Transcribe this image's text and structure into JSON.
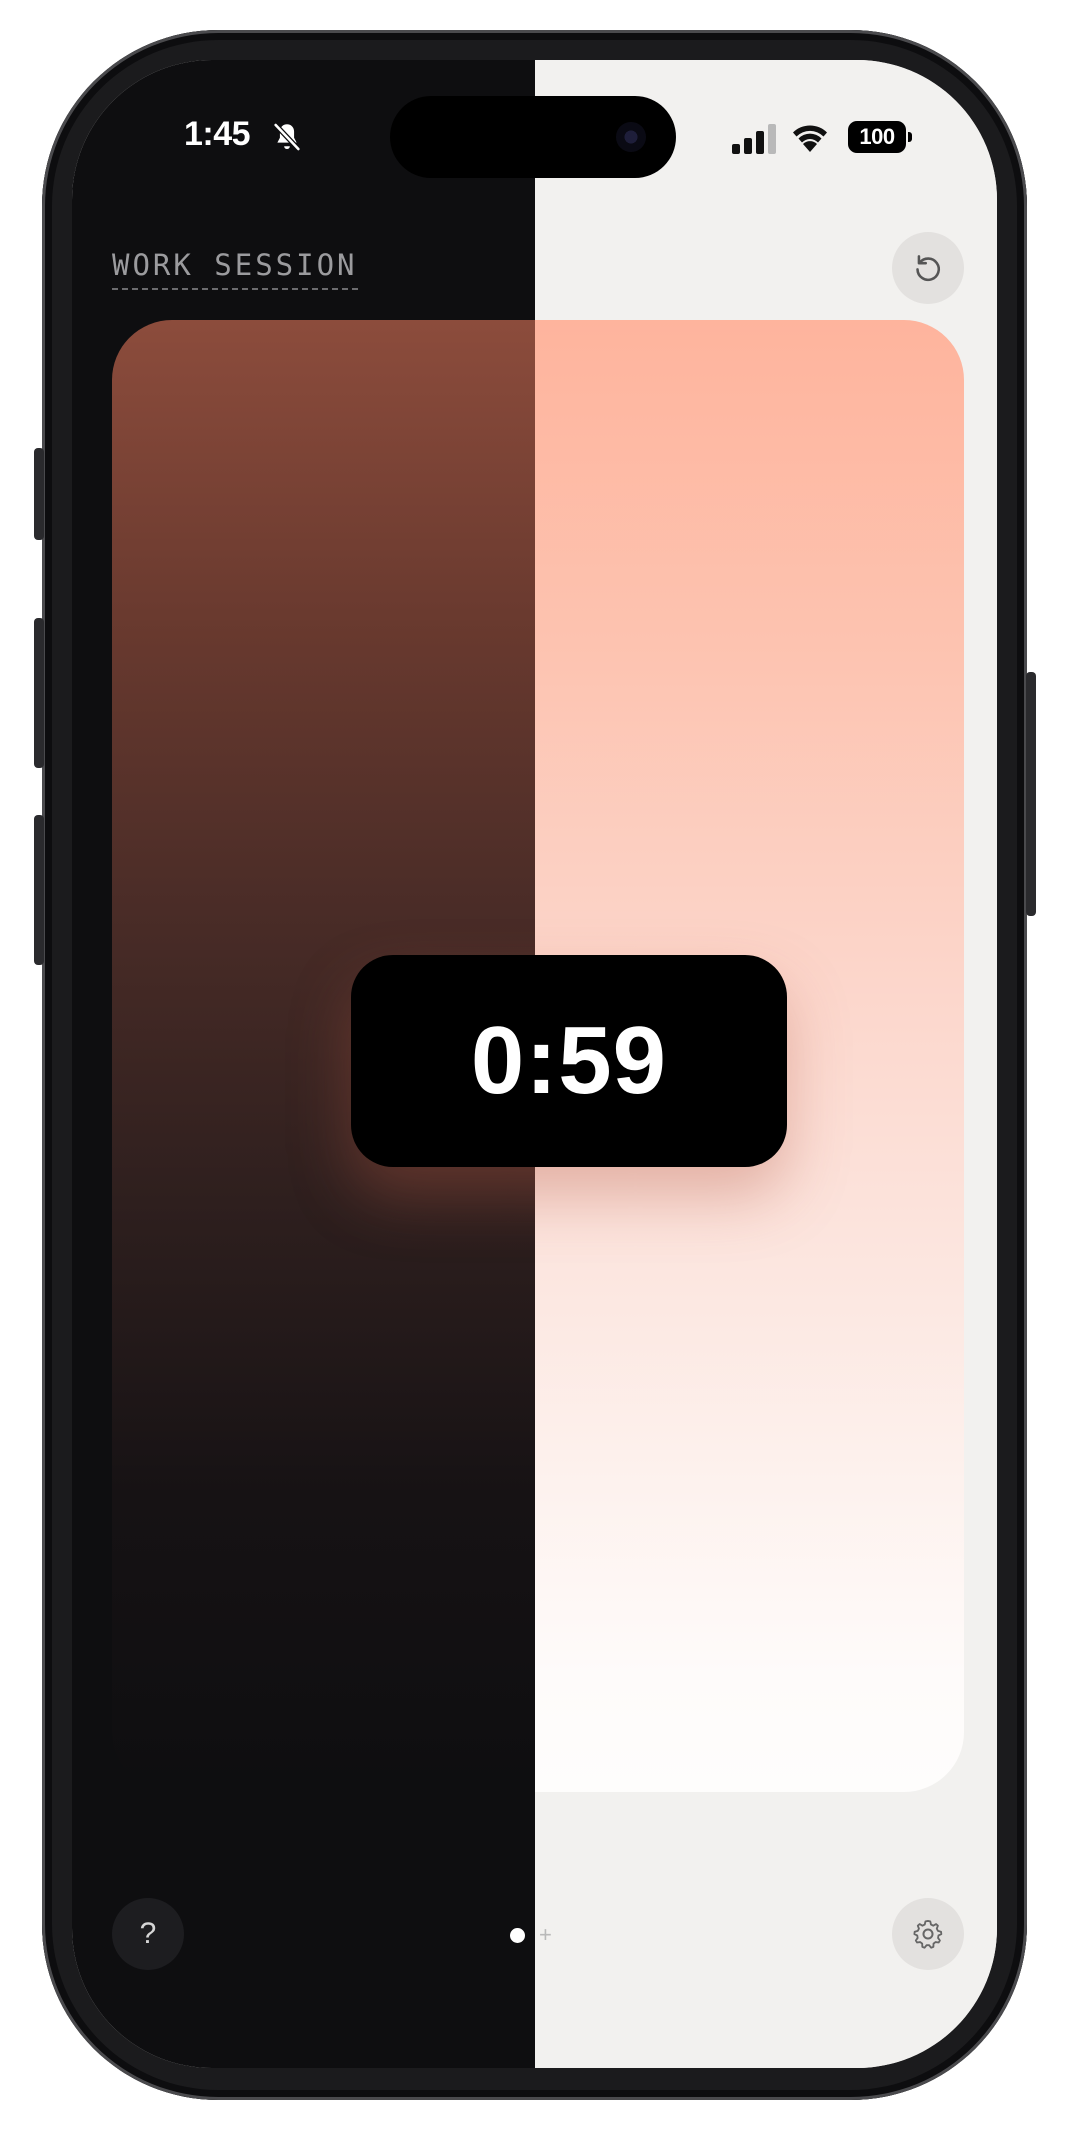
{
  "status_bar": {
    "time": "1:45",
    "battery": "100",
    "icons": [
      "bell-slash-icon",
      "signal-icon",
      "wifi-icon",
      "battery-icon"
    ]
  },
  "header": {
    "session_label": "WORK SESSION",
    "reset_icon": "reset-icon"
  },
  "timer": {
    "value": "0:59"
  },
  "footer": {
    "help_label": "?",
    "add_page_label": "+",
    "settings_icon": "gear-icon"
  },
  "colors": {
    "dark_bg": "#0e0e10",
    "light_bg": "#f2f1ef",
    "accent_dark": "#8c4c3c",
    "accent_light": "#feb49d"
  }
}
